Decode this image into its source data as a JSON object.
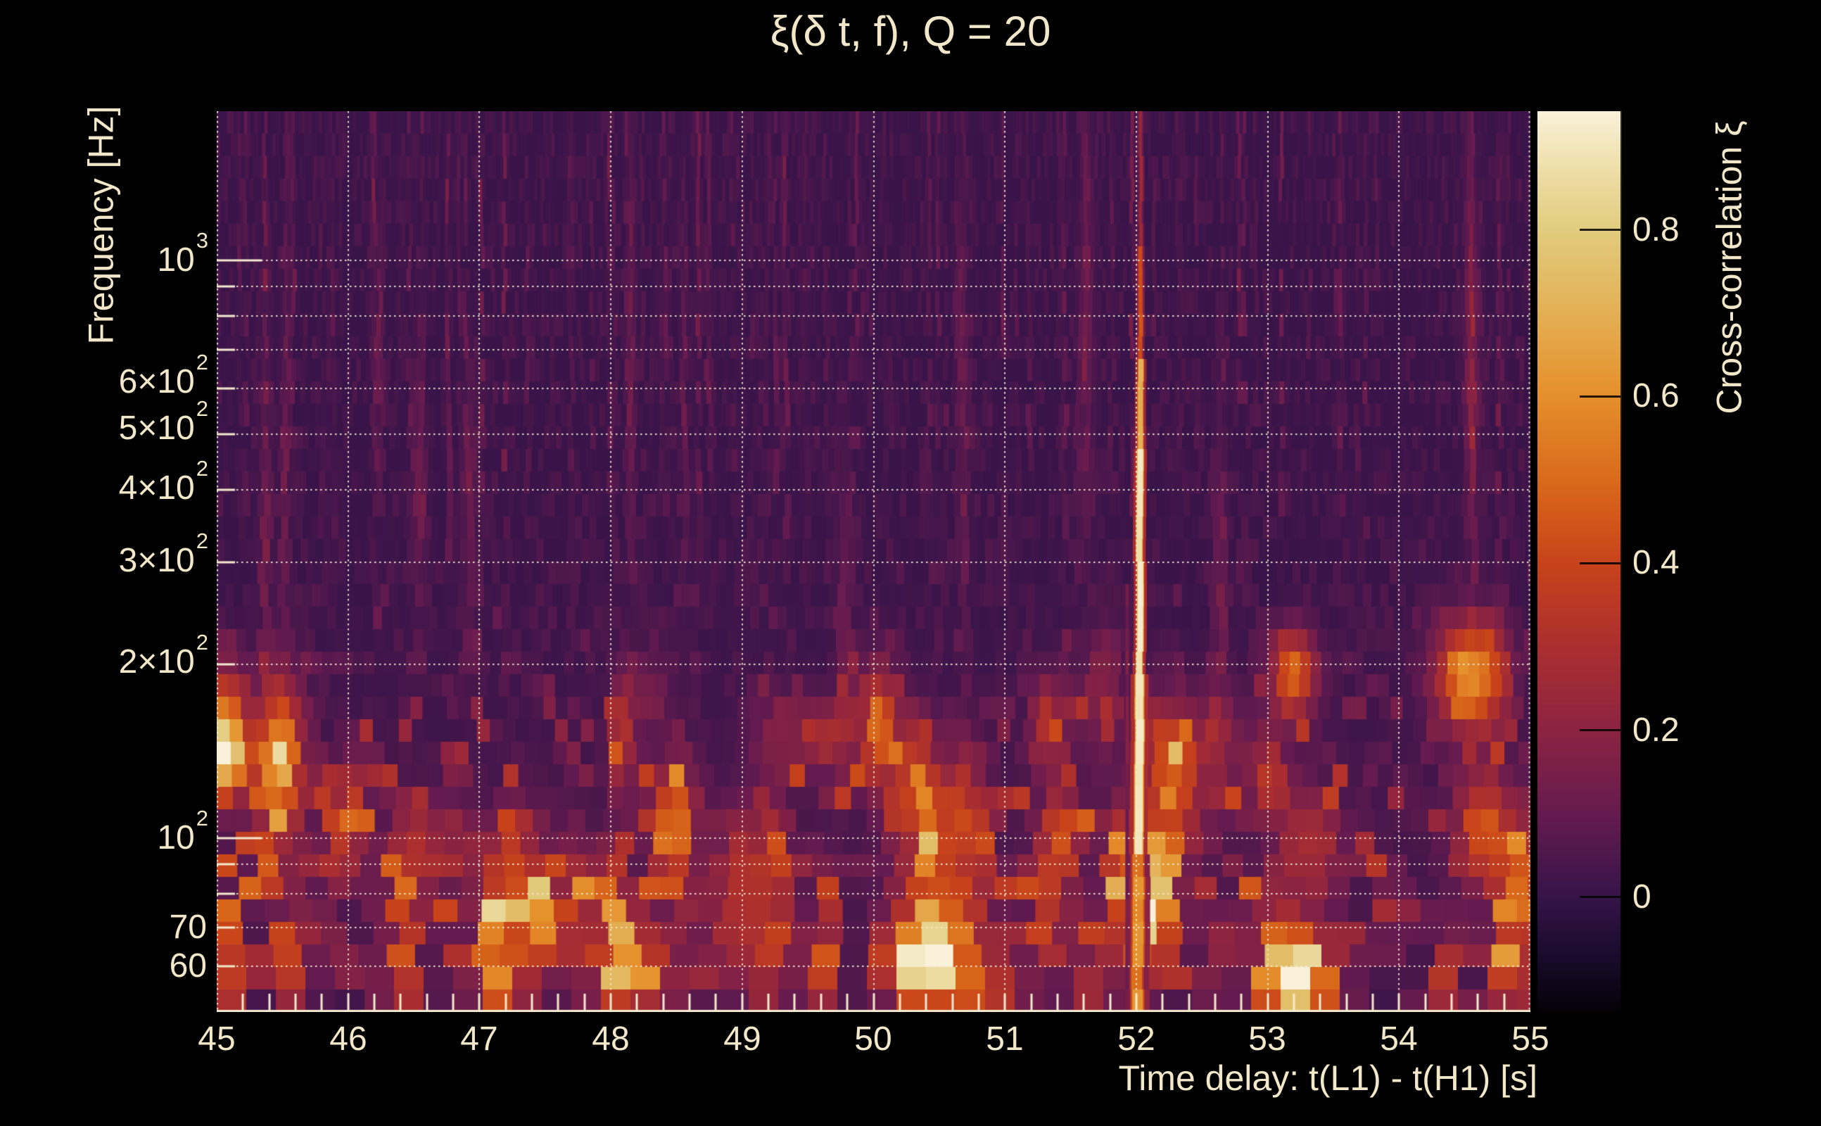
{
  "title": "ξ(δ t, f), Q = 20",
  "x_axis": {
    "label": "Time delay: t(L1) - t(H1) [s]",
    "ticks": [
      "45",
      "46",
      "47",
      "48",
      "49",
      "50",
      "51",
      "52",
      "53",
      "54",
      "55"
    ]
  },
  "y_axis": {
    "label": "Frequency [Hz]",
    "scale": "log",
    "ticks": [
      {
        "base": "10",
        "exp": "3"
      },
      {
        "base": "6×10",
        "exp": "2"
      },
      {
        "base": "5×10",
        "exp": "2"
      },
      {
        "base": "4×10",
        "exp": "2"
      },
      {
        "base": "3×10",
        "exp": "2"
      },
      {
        "base": "2×10",
        "exp": "2"
      },
      {
        "base": "10",
        "exp": "2"
      },
      {
        "base": "70",
        "exp": ""
      },
      {
        "base": "60",
        "exp": ""
      }
    ]
  },
  "colorbar": {
    "label": "Cross-correlation ξ",
    "tick_labels": [
      "0.8",
      "0.6",
      "0.4",
      "0.2",
      "0"
    ],
    "tick_values": [
      0.8,
      0.6,
      0.4,
      0.2,
      0
    ]
  },
  "chart_data": {
    "type": "heatmap",
    "title": "ξ(δ t, f), Q = 20",
    "xlabel": "Time delay: t(L1) - t(H1) [s]",
    "ylabel": "Frequency [Hz]",
    "colorbar_label": "Cross-correlation ξ",
    "xlim": [
      45,
      55
    ],
    "ylim_hz": [
      50,
      1810
    ],
    "y_scale": "log",
    "color_range": [
      -0.137,
      0.943
    ],
    "colorbar_ticks": [
      0.8,
      0.6,
      0.4,
      0.2,
      0
    ],
    "time_gridlines_s": [
      45,
      46,
      47,
      48,
      49,
      50,
      51,
      52,
      53,
      54,
      55
    ],
    "freq_gridlines_hz": [
      60,
      70,
      80,
      90,
      100,
      200,
      300,
      400,
      500,
      600,
      700,
      800,
      900,
      1000
    ],
    "background_xi_level": 0.0,
    "noise": {
      "elevated_band_hz": [
        50,
        180
      ],
      "typical_blob_xi": [
        0.2,
        0.55
      ],
      "texture": "fine vertical striations at high frequency, blocky blotches below ~200 Hz"
    },
    "event": {
      "time_delay_s": 52.0,
      "freq_extent_hz": [
        50,
        1800
      ],
      "peak_xi": 0.9,
      "brightest_band_hz": [
        100,
        460
      ],
      "description": "narrow bright vertical ridge of high cross-correlation at ~52 s time delay"
    },
    "colormap_stops": [
      [
        0.0,
        "#050108"
      ],
      [
        0.07,
        "#1c0c30"
      ],
      [
        0.13,
        "#371449"
      ],
      [
        0.22,
        "#651b4f"
      ],
      [
        0.32,
        "#8e2440"
      ],
      [
        0.41,
        "#ac2f2e"
      ],
      [
        0.5,
        "#c8431a"
      ],
      [
        0.58,
        "#d8651a"
      ],
      [
        0.69,
        "#e5912c"
      ],
      [
        0.78,
        "#e3b156"
      ],
      [
        0.87,
        "#e2cc7e"
      ],
      [
        0.94,
        "#efe0ab"
      ],
      [
        1.0,
        "#f9f1da"
      ]
    ]
  }
}
